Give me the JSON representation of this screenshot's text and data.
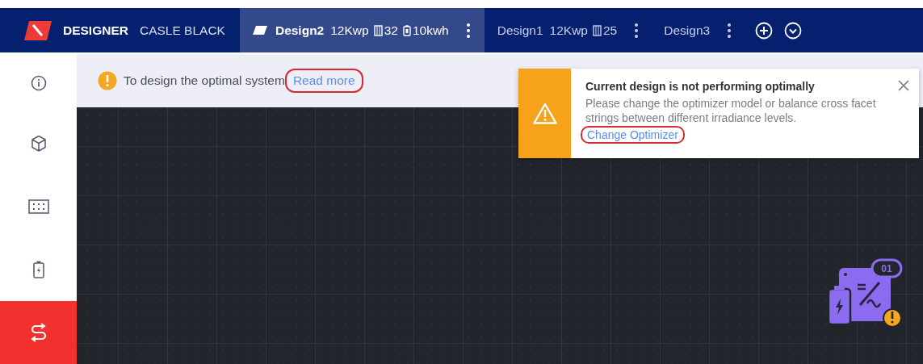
{
  "header": {
    "app_name": "DESIGNER",
    "project": "CASLE BLACK"
  },
  "tabs": [
    {
      "name": "Design2",
      "power": "12Kwp",
      "panels": "32",
      "battery": "10kwh",
      "selected": true
    },
    {
      "name": "Design1",
      "power": "12Kwp",
      "panels": "25",
      "selected": false
    },
    {
      "name": "Design3",
      "selected": false
    }
  ],
  "sidebar": {
    "items": [
      {
        "kind": "info",
        "selected": false
      },
      {
        "kind": "cube",
        "selected": false
      },
      {
        "kind": "panels",
        "selected": false
      },
      {
        "kind": "battery",
        "selected": false
      },
      {
        "kind": "strings",
        "selected": true
      }
    ]
  },
  "banner": {
    "text": "To design the optimal system",
    "link": "Read more"
  },
  "alert": {
    "title": "Current design is not performing optimally",
    "message": "Please change the optimizer model or balance cross facet strings between different irradiance levels.",
    "action": "Change Optimizer"
  },
  "canvas": {
    "device": {
      "badge": "01"
    }
  }
}
